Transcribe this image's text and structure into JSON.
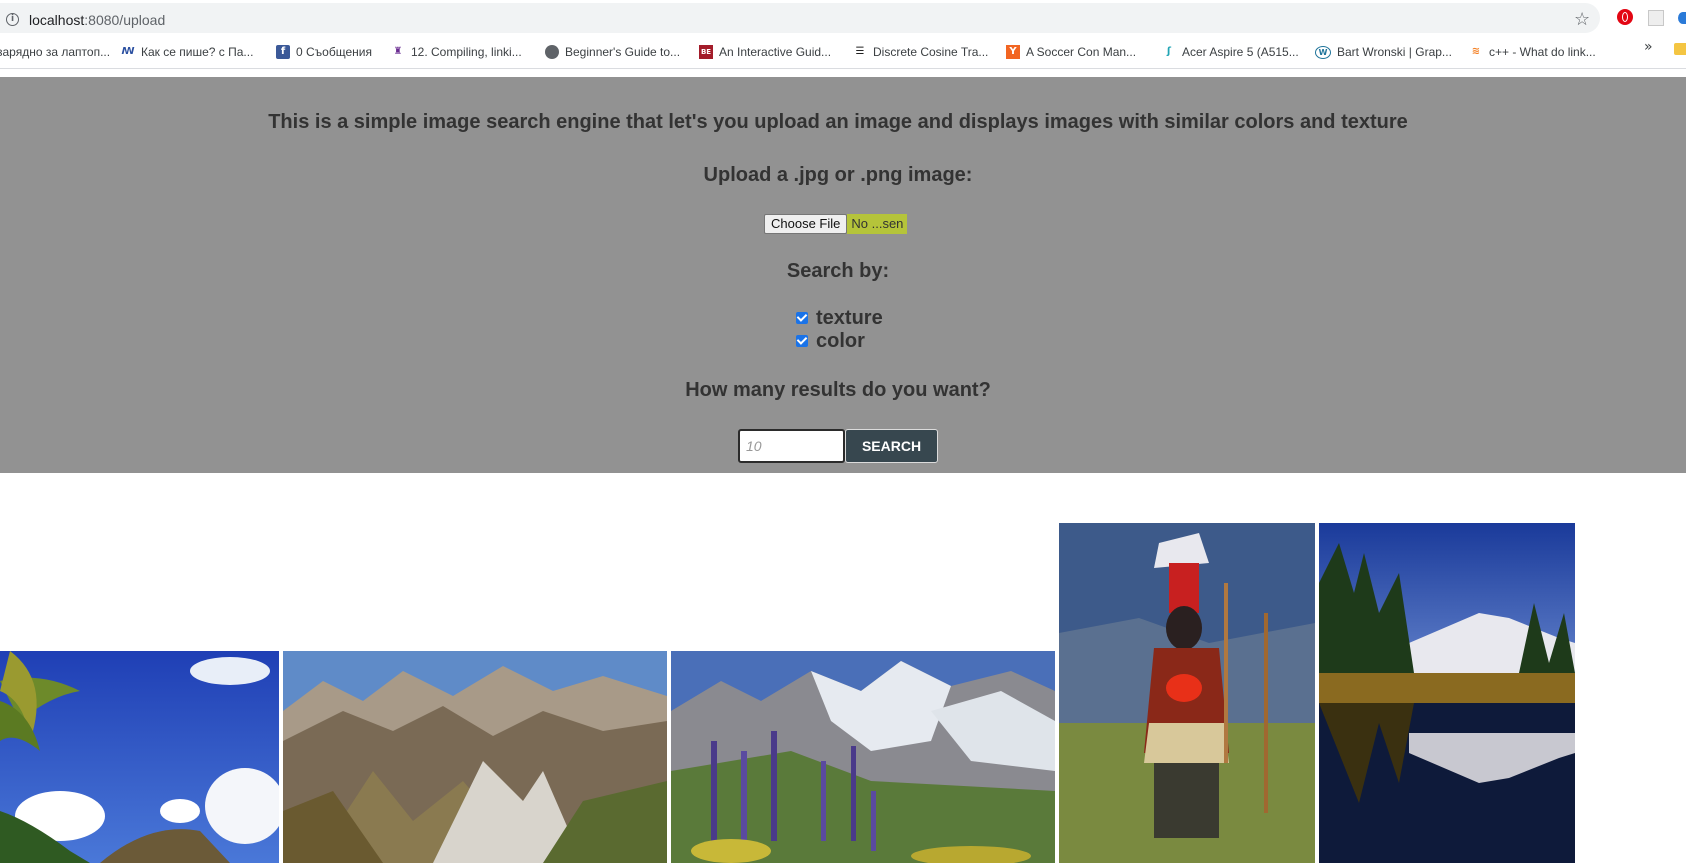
{
  "browser": {
    "url_host": "localhost",
    "url_path": ":8080/upload",
    "bookmarks": [
      {
        "label": "зарядно за лаптоп...",
        "icon": "none"
      },
      {
        "label": "Как се пише? с Па...",
        "icon": "kak-se-pishe-icon"
      },
      {
        "label": "0 Съобщения",
        "icon": "facebook-icon"
      },
      {
        "label": "12. Compiling, linki...",
        "icon": "purple-shield-icon"
      },
      {
        "label": "Beginner's Guide to...",
        "icon": "globe-icon"
      },
      {
        "label": "An Interactive Guid...",
        "icon": "be-icon"
      },
      {
        "label": "Discrete Cosine Tra...",
        "icon": "wiki-icon"
      },
      {
        "label": "A Soccer Con Man...",
        "icon": "y-combinator-icon"
      },
      {
        "label": "Acer Aspire 5 (A515...",
        "icon": "acer-icon"
      },
      {
        "label": "Bart Wronski | Grap...",
        "icon": "wordpress-icon"
      },
      {
        "label": "c++ - What do link...",
        "icon": "stackoverflow-icon"
      }
    ],
    "more_label": "»"
  },
  "panel": {
    "intro": "This is a simple image search engine that let's you upload an image and displays images with similar colors and texture",
    "upload_label": "Upload a .jpg or .png image:",
    "choose_file_label": "Choose File",
    "file_name": "No ...sen",
    "search_by_label": "Search by:",
    "options": [
      {
        "label": "texture",
        "checked": true
      },
      {
        "label": "color",
        "checked": true
      }
    ],
    "results_label": "How many results do you want?",
    "count_placeholder": "10",
    "search_button": "SEARCH"
  },
  "results": [
    {
      "name": "beach-palm-image",
      "subject": "tropical beach with palm trees"
    },
    {
      "name": "rocky-mountains-image",
      "subject": "rocky mountain ridges"
    },
    {
      "name": "alpine-flowers-image",
      "subject": "snowy peaks with purple lupines"
    },
    {
      "name": "tribal-dancer-image",
      "subject": "tribal dancer with feather headdress"
    },
    {
      "name": "mountain-lake-image",
      "subject": "lake reflecting snowy mountain"
    }
  ],
  "colors": {
    "panel_bg": "#929292",
    "search_button_bg": "#37474f",
    "file_name_bg": "#b5c43a",
    "checkbox": "#1a73e8"
  }
}
